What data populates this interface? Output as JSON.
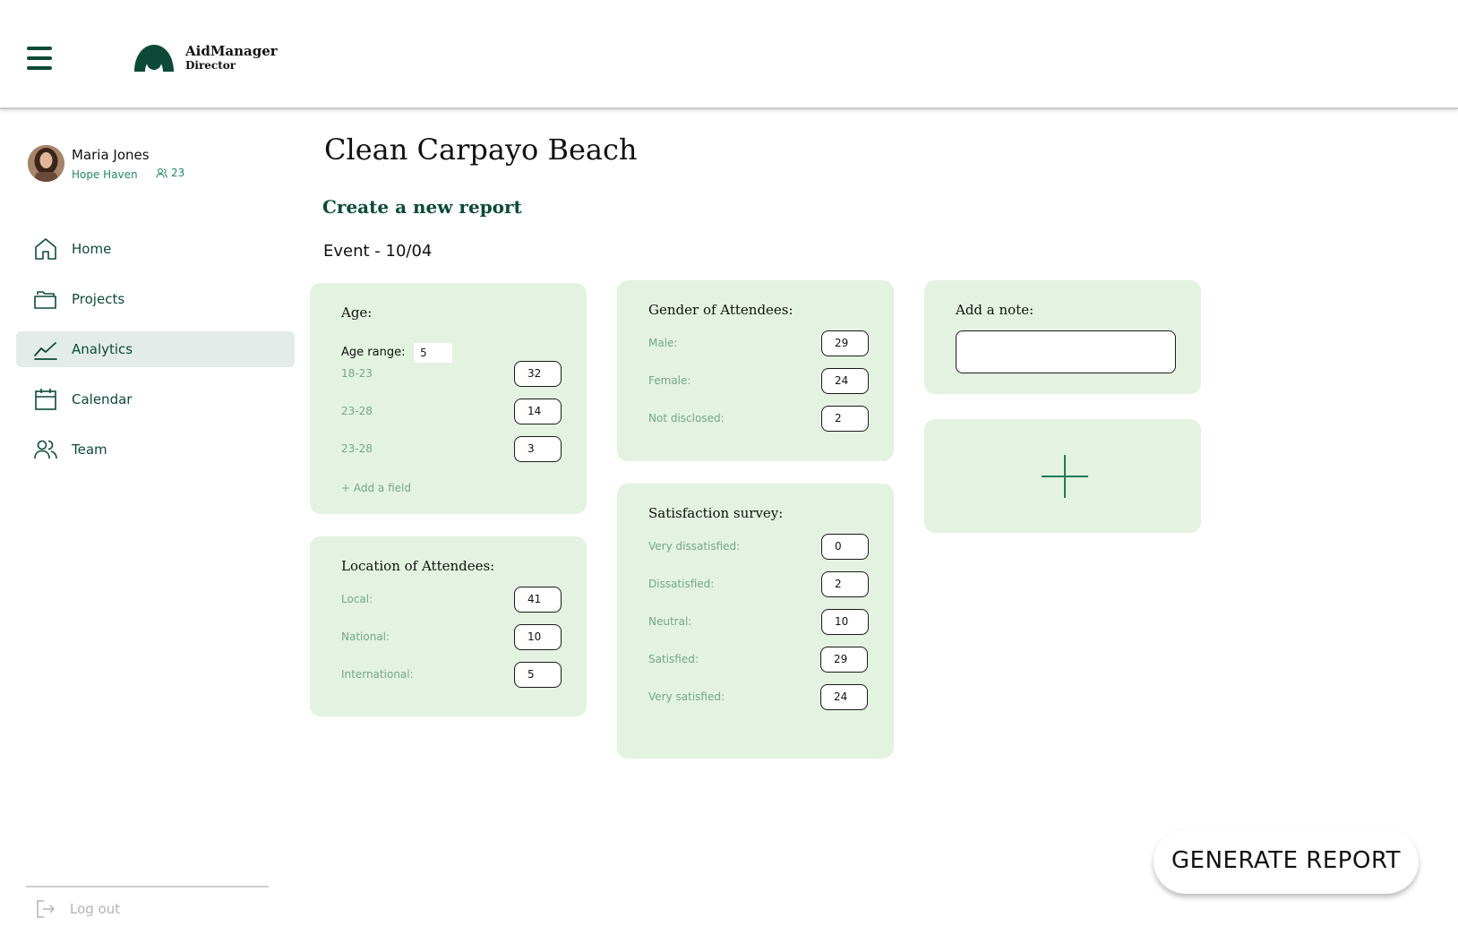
{
  "header": {
    "brand_name": "AidManager",
    "brand_role": "Director"
  },
  "profile": {
    "name": "Maria Jones",
    "organization": "Hope Haven",
    "member_count": "23"
  },
  "nav": {
    "items": [
      {
        "label": "Home",
        "icon": "home-icon"
      },
      {
        "label": "Projects",
        "icon": "folder-icon"
      },
      {
        "label": "Analytics",
        "icon": "chart-line-icon",
        "active": true
      },
      {
        "label": "Calendar",
        "icon": "calendar-icon"
      },
      {
        "label": "Team",
        "icon": "team-icon"
      }
    ],
    "logout_label": "Log out"
  },
  "main": {
    "page_title": "Clean Carpayo Beach",
    "section_title": "Create a new report",
    "event_title": "Event - 10/04"
  },
  "cards": {
    "age": {
      "title": "Age:",
      "age_range_label": "Age range:",
      "age_range_value": "5",
      "rows": [
        {
          "label": "18-23",
          "value": "32"
        },
        {
          "label": "23-28",
          "value": "14"
        },
        {
          "label": "23-28",
          "value": "3"
        }
      ],
      "add_field": "+ Add a field"
    },
    "location": {
      "title": "Location of Attendees:",
      "rows": [
        {
          "label": "Local:",
          "value": "41"
        },
        {
          "label": "National:",
          "value": "10"
        },
        {
          "label": "International:",
          "value": "5"
        }
      ]
    },
    "gender": {
      "title": "Gender of Attendees:",
      "rows": [
        {
          "label": "Male:",
          "value": "29"
        },
        {
          "label": "Female:",
          "value": "24"
        },
        {
          "label": "Not disclosed:",
          "value": "2"
        }
      ]
    },
    "satisfaction": {
      "title": "Satisfaction survey:",
      "rows": [
        {
          "label": "Very dissatisfied:",
          "value": "0"
        },
        {
          "label": "Dissatisfied:",
          "value": "2"
        },
        {
          "label": "Neutral:",
          "value": "10"
        },
        {
          "label": "Satisfied:",
          "value": "29"
        },
        {
          "label": "Very satisfied:",
          "value": "24"
        }
      ]
    },
    "note": {
      "title": "Add a note:",
      "value": ""
    }
  },
  "actions": {
    "generate_label": "GENERATE REPORT"
  },
  "colors": {
    "brand": "#0c4a37",
    "accent": "#1f8a5f",
    "card_bg": "#e4f2e1",
    "nav_active_bg": "#e3ece8"
  }
}
